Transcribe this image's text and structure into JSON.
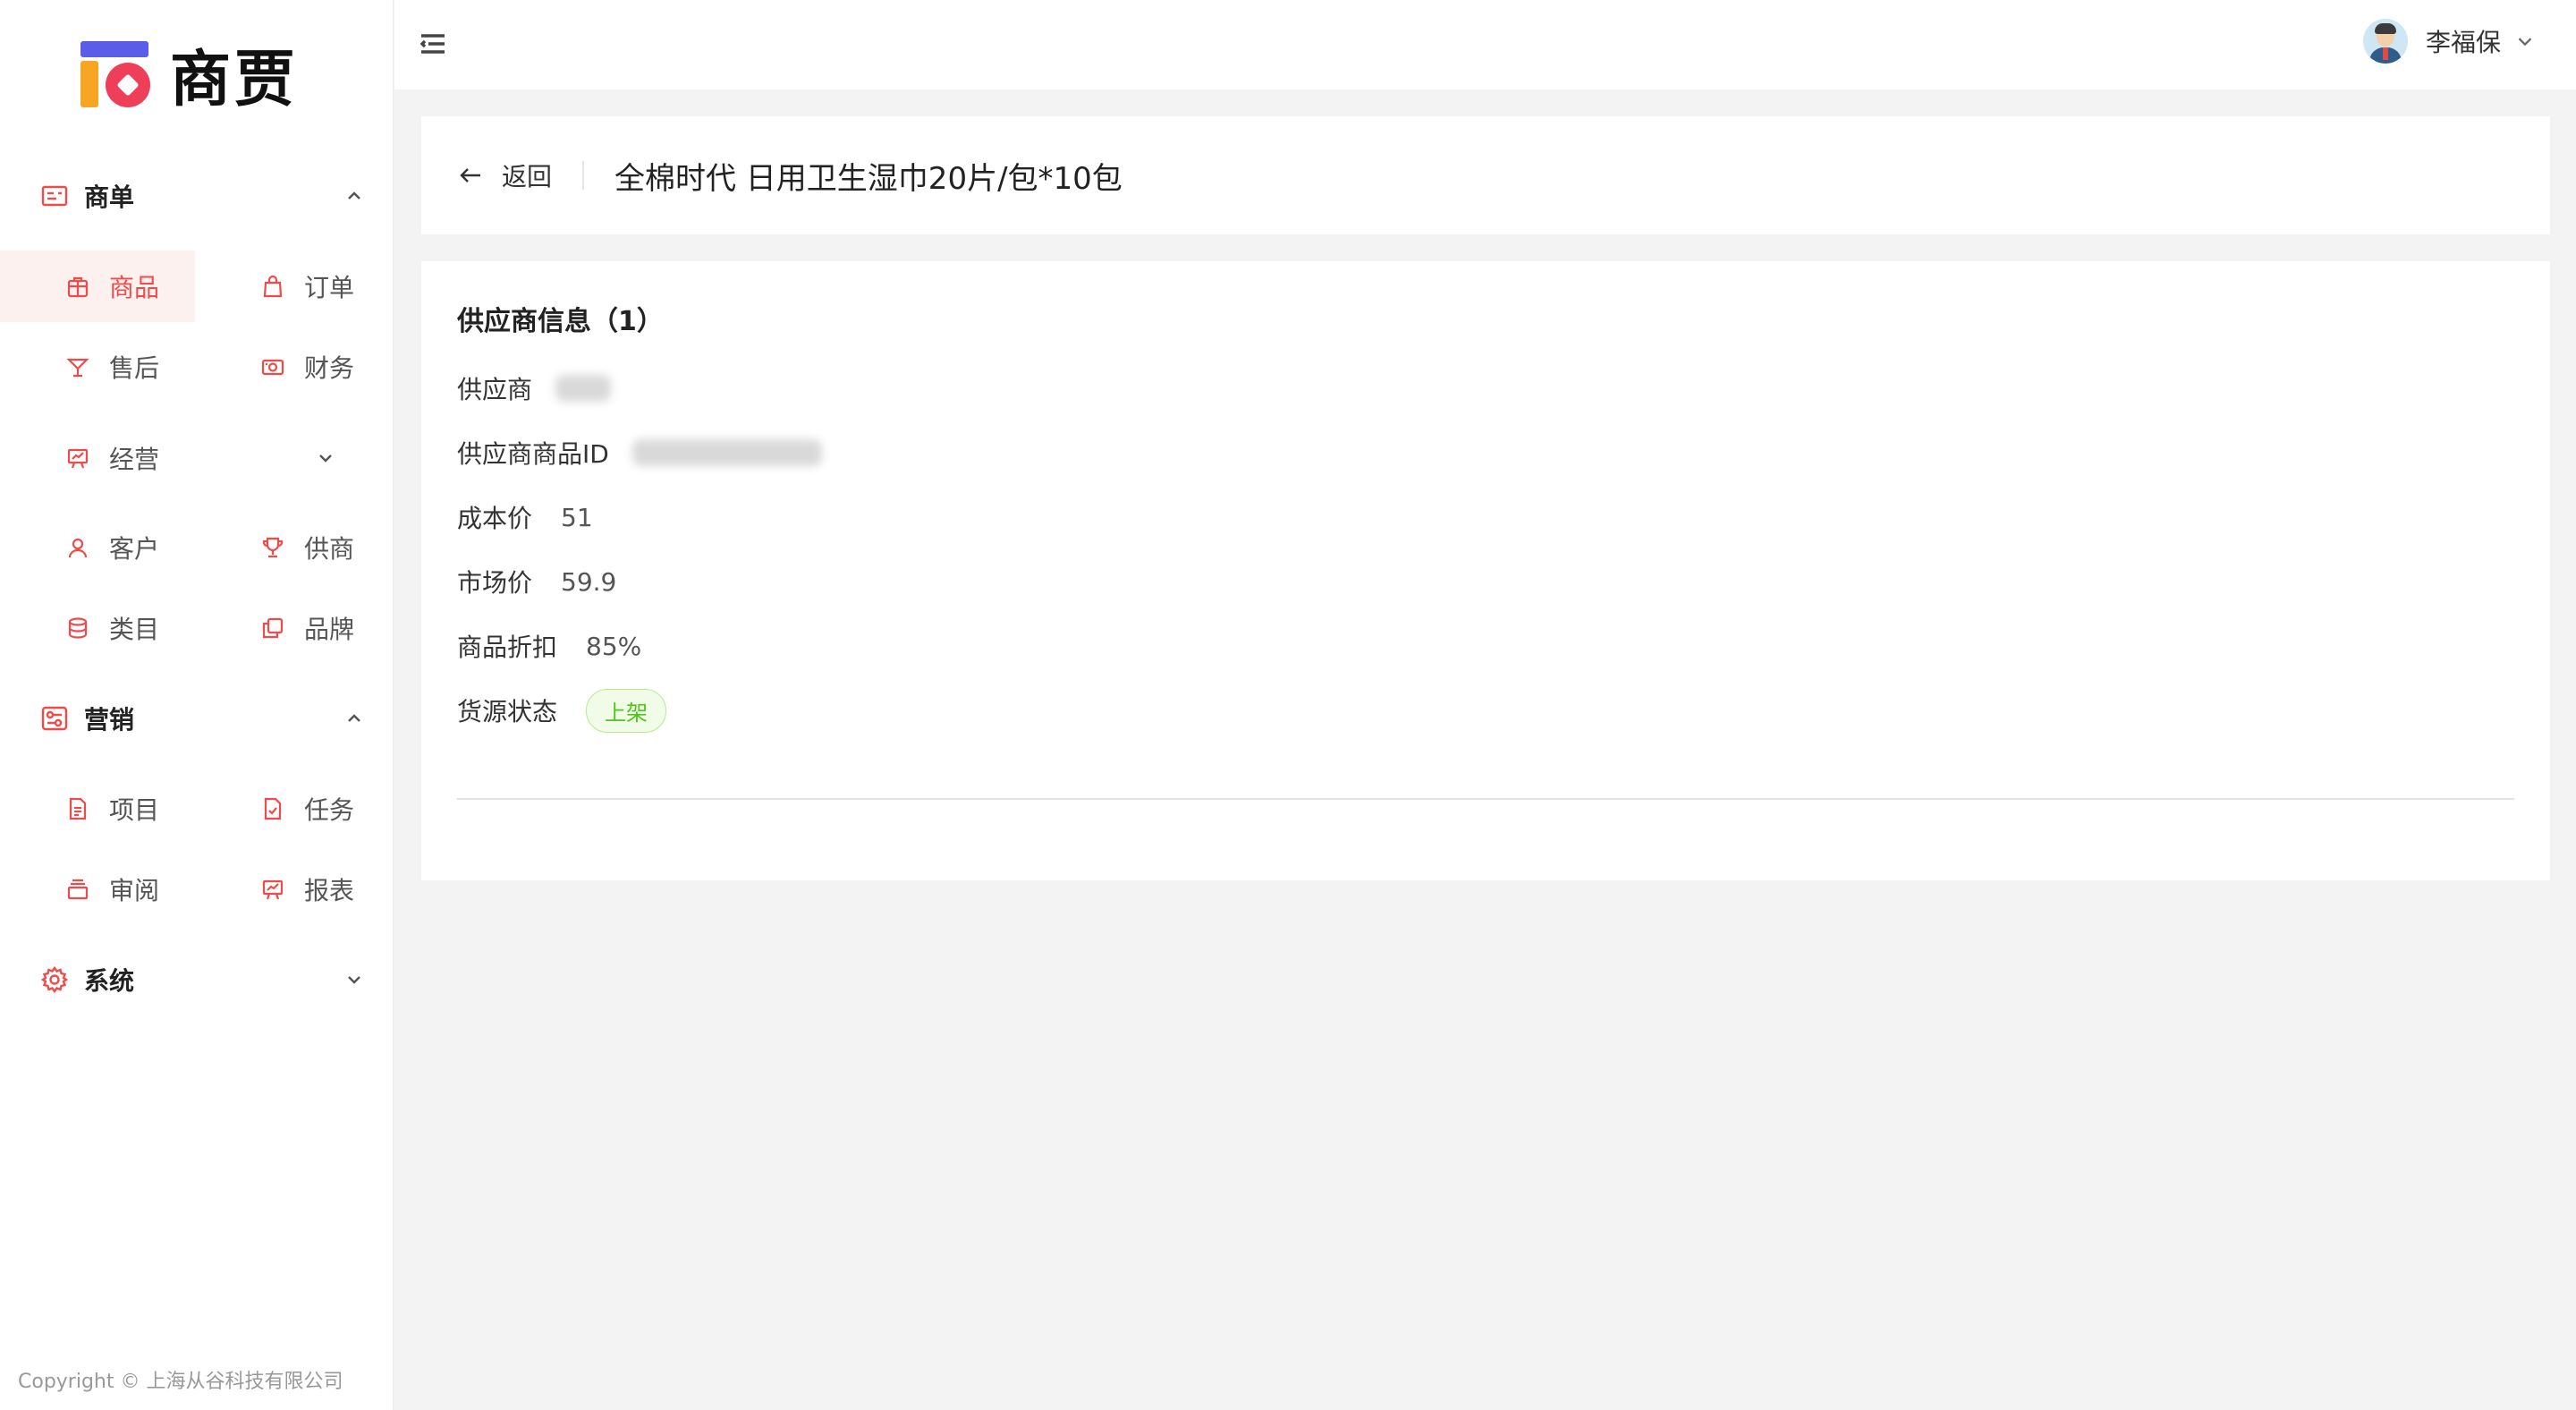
{
  "brand": {
    "name": "商贾"
  },
  "sidebar": {
    "groups": [
      {
        "label": "商单"
      },
      {
        "label": "营销"
      },
      {
        "label": "系统"
      }
    ],
    "items": {
      "goods": "商品",
      "orders": "订单",
      "aftersale": "售后",
      "finance": "财务",
      "operation": "经营",
      "customers": "客户",
      "suppliers": "供商",
      "category": "类目",
      "brand": "品牌",
      "project": "项目",
      "task": "任务",
      "review": "审阅",
      "report": "报表"
    },
    "copyright": "Copyright © 上海从谷科技有限公司"
  },
  "topbar": {
    "user_name": "李福保"
  },
  "header": {
    "back_label": "返回",
    "title": "全棉时代 日用卫生湿巾20片/包*10包"
  },
  "supplier_info": {
    "section_title": "供应商信息（1）",
    "supplier_label": "供应商",
    "supplier_product_id_label": "供应商商品ID",
    "cost_price_label": "成本价",
    "cost_price": "51",
    "market_price_label": "市场价",
    "market_price": "59.9",
    "discount_label": "商品折扣",
    "discount": "85%",
    "status_label": "货源状态",
    "status": "上架"
  },
  "colors": {
    "accent": "#ef4b4b",
    "active_bg": "#fdf1f0",
    "status_green": "#52c41a"
  }
}
